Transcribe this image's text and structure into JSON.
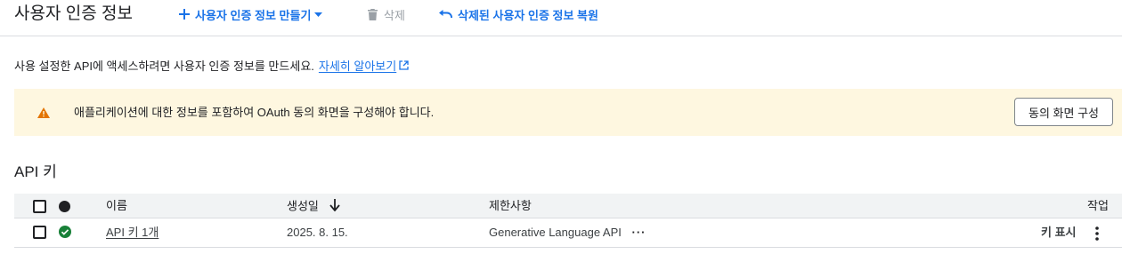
{
  "colors": {
    "accent": "#1a73e8",
    "visited_link": "#681da8",
    "warning_bg": "#fef7e0",
    "warning_icon": "#e37400",
    "status_ok": "#188038"
  },
  "toolbar": {
    "title": "사용자 인증 정보",
    "create_label": "사용자 인증 정보 만들기",
    "delete_label": "삭제",
    "restore_label": "삭제된 사용자 인증 정보 복원"
  },
  "intro": {
    "text": "사용 설정한 API에 액세스하려면 사용자 인증 정보를 만드세요.",
    "link_label": "자세히 알아보기"
  },
  "banner": {
    "icon": "warning-icon",
    "text": "애플리케이션에 대한 정보를 포함하여 OAuth 동의 화면을 구성해야 합니다.",
    "button_label": "동의 화면 구성"
  },
  "api_keys": {
    "title": "API 키",
    "columns": {
      "name": "이름",
      "created": "생성일",
      "restrictions": "제한사항",
      "actions": "작업"
    },
    "sort": {
      "column": "created",
      "direction": "desc",
      "icon": "arrow-down-icon"
    },
    "rows": [
      {
        "name": "API 키 1개",
        "created": "2025. 8. 15.",
        "restrictions": "Generative Language API",
        "more": "···",
        "show_key_label": "키 표시",
        "status_icon": "check-circle-icon"
      }
    ]
  }
}
